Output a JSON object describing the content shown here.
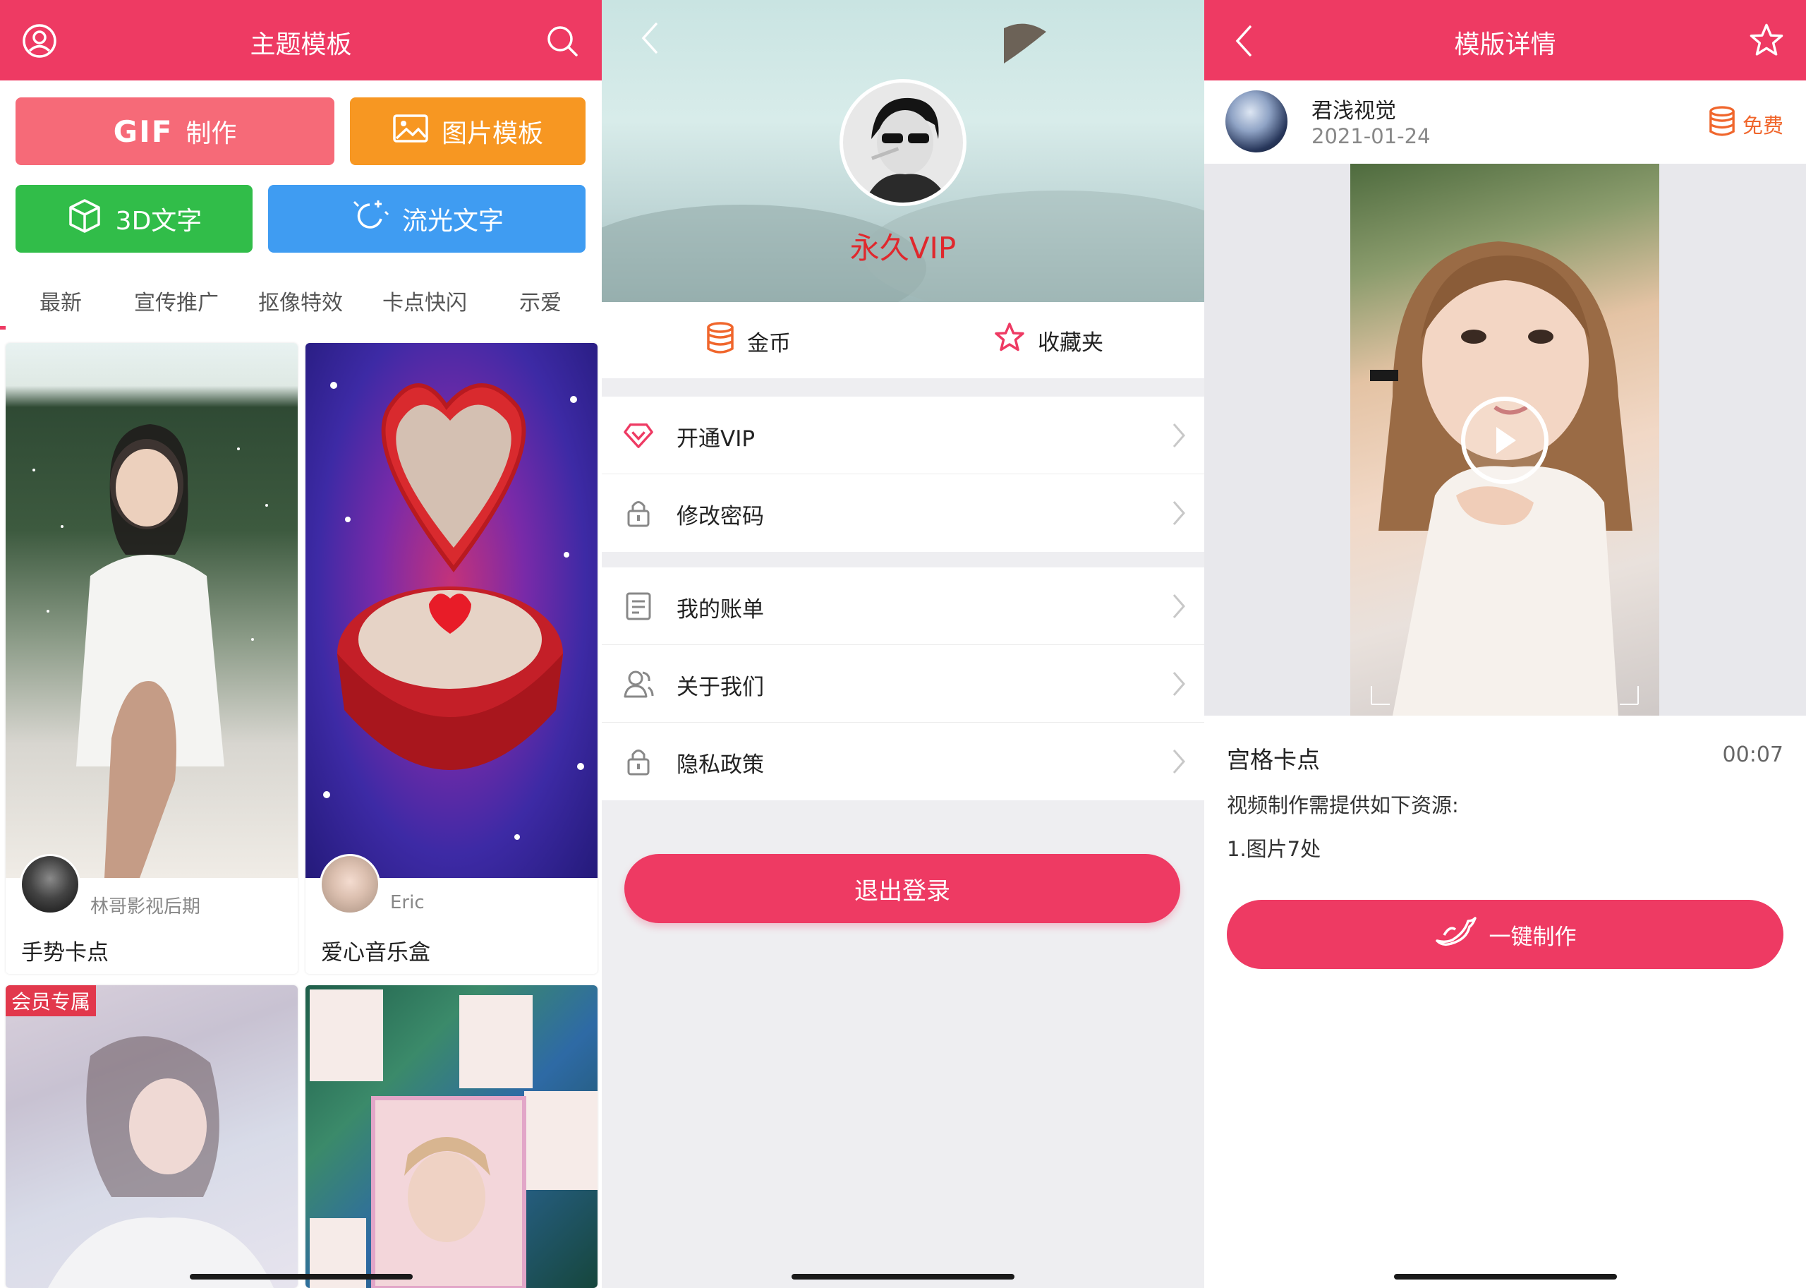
{
  "home": {
    "title": "主题模板",
    "buttons": [
      {
        "label_strong": "GIF",
        "label": "制作"
      },
      {
        "label": "图片模板"
      },
      {
        "label": "3D文字"
      },
      {
        "label": "流光文字"
      }
    ],
    "categories": [
      "最新",
      "宣传推广",
      "抠像特效",
      "卡点快闪",
      "示爱"
    ],
    "cards": [
      {
        "author": "林哥影视后期",
        "name": "手势卡点"
      },
      {
        "author": "Eric",
        "name": "爱心音乐盒"
      },
      {
        "tag": "会员专属"
      },
      {}
    ]
  },
  "profile": {
    "vip_label": "永久VIP",
    "quick": [
      {
        "label": "金币",
        "icon": "coin-stack-icon"
      },
      {
        "label": "收藏夹",
        "icon": "star-icon"
      }
    ],
    "menu_group_1": [
      {
        "label": "开通VIP",
        "icon": "diamond-icon"
      },
      {
        "label": "修改密码",
        "icon": "lock-icon"
      }
    ],
    "menu_group_2": [
      {
        "label": "我的账单",
        "icon": "bill-icon"
      },
      {
        "label": "关于我们",
        "icon": "people-icon"
      },
      {
        "label": "隐私政策",
        "icon": "lock-icon"
      }
    ],
    "logout_label": "退出登录"
  },
  "detail": {
    "title": "模版详情",
    "author_name": "君浅视觉",
    "author_date": "2021-01-24",
    "price_label": "免费",
    "template_name": "宫格卡点",
    "duration": "00:07",
    "requirement_title": "视频制作需提供如下资源:",
    "requirement_item": "1.图片7处",
    "make_label": "一键制作"
  },
  "colors": {
    "brand": "#ee3a63",
    "gif_button": "#f66a78",
    "image_button": "#f79722",
    "text3d_button": "#31bd49",
    "flow_button": "#3f9cf2",
    "vip_text": "#e0282d",
    "free_badge": "#f0662c"
  }
}
